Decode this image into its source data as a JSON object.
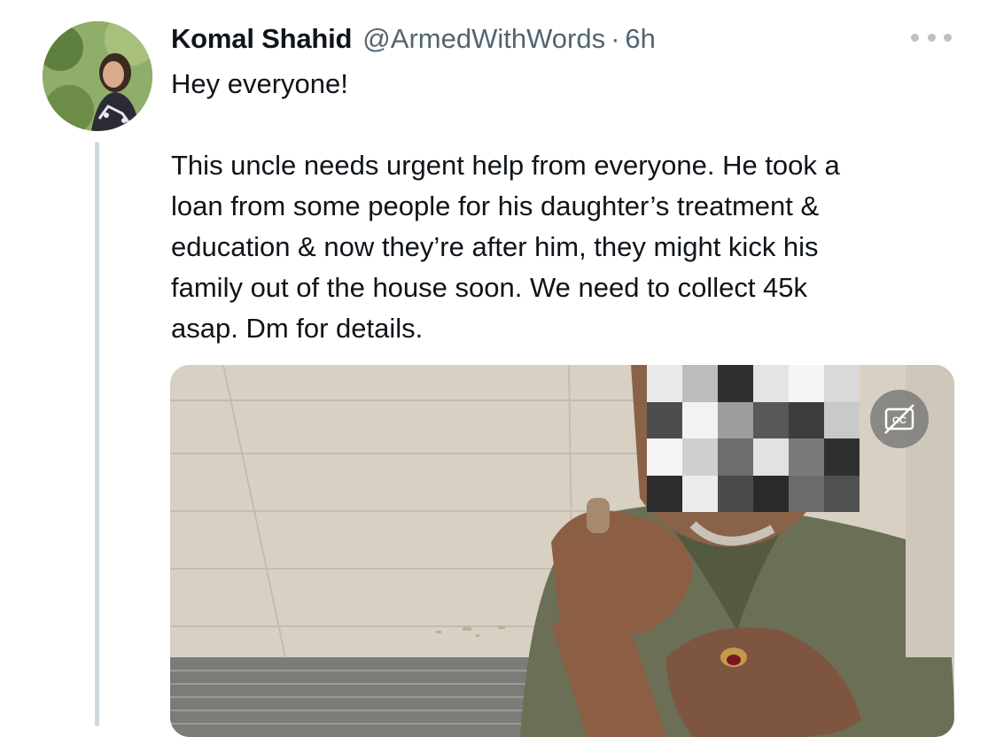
{
  "tweet": {
    "author_name": "Komal Shahid",
    "handle": "@ArmedWithWords",
    "separator": "·",
    "time": "6h",
    "text": "Hey everyone!\n\nThis uncle needs urgent help from everyone. He took a\nloan from some people for his daughter’s treatment &\neducation & now they’re after him, they might kick his\nfamily out of the house soon. We need to collect 45k\nasap. Dm for details."
  },
  "icons": {
    "more": "more-horizontal-icon",
    "captions": "closed-captions-off-icon"
  },
  "colors": {
    "text_primary": "#0f1419",
    "text_secondary": "#536471",
    "thread_line": "#cfd9de"
  }
}
